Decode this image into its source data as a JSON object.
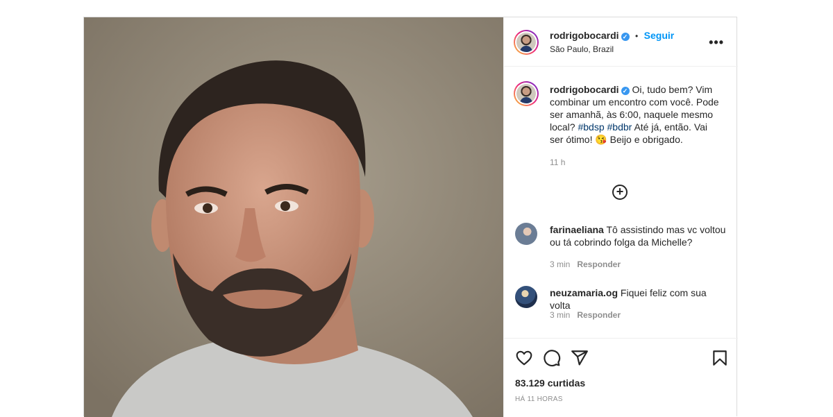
{
  "post": {
    "username": "rodrigobocardi",
    "follow_label": "Seguir",
    "separator": "•",
    "location": "São Paulo, Brazil",
    "more_label": "•••"
  },
  "caption": {
    "username": "rodrigobocardi",
    "text_part1": "Oi, tudo bem? Vim combinar um encontro com você. Pode ser amanhã, às 6:00, naquele mesmo local? ",
    "hashtag1": "#bdsp",
    "hashtag2": "#bdbr",
    "text_part2": " Até já, então. Vai ser ótimo! ",
    "emoji": "😘",
    "text_part3": " Beijo e obrigado.",
    "time": "11 h"
  },
  "load_more_label": "+",
  "comments": [
    {
      "username": "farinaeliana",
      "text": "Tô assistindo mas vc voltou ou tá cobrindo folga da Michelle?",
      "time": "3 min",
      "reply_label": "Responder"
    },
    {
      "username": "neuzamaria.og",
      "text": "Fiquei feliz com sua volta",
      "time": "3 min",
      "reply_label": "Responder"
    }
  ],
  "footer": {
    "likes": "83.129 curtidas",
    "posted_ago": "HÁ 11 HORAS"
  },
  "icons": [
    "heart-icon",
    "comment-icon",
    "share-icon",
    "bookmark-icon",
    "add-comment-icon",
    "verified-icon",
    "more-icon"
  ],
  "colors": {
    "link_blue": "#0095f6",
    "verified_blue": "#3897f0",
    "hashtag": "#00376b",
    "muted": "#8e8e8e",
    "text": "#262626"
  }
}
